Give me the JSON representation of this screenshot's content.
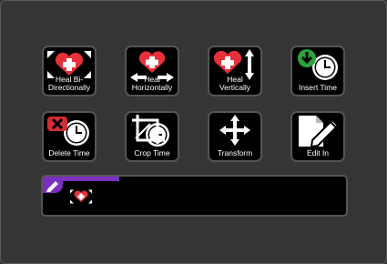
{
  "tools": [
    {
      "label": "Heal Bi-\nDirectionally",
      "icon": "heal-bidirectional-icon"
    },
    {
      "label": "Heal\nHorizontally",
      "icon": "heal-horizontal-icon"
    },
    {
      "label": "Heal\nVertically",
      "icon": "heal-vertical-icon"
    },
    {
      "label": "Insert Time",
      "icon": "insert-time-icon"
    },
    {
      "label": "Delete Time",
      "icon": "delete-time-icon"
    },
    {
      "label": "Crop Time",
      "icon": "crop-time-icon"
    },
    {
      "label": "Transform",
      "icon": "transform-icon"
    },
    {
      "label": "Edit In",
      "icon": "edit-in-icon"
    }
  ],
  "colors": {
    "heart": "#e8303a",
    "accent": "#7a2fbf",
    "insert_green": "#2aa43a",
    "delete_red": "#d22d37"
  }
}
